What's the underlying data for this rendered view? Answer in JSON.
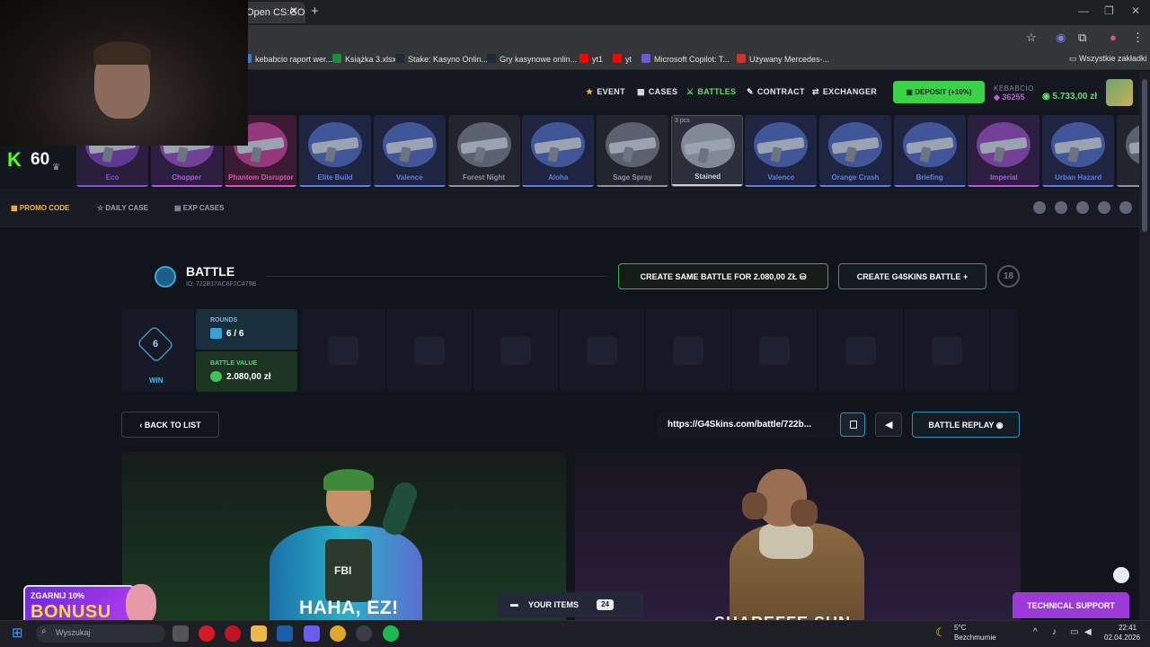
{
  "browser": {
    "tab_title": "Open CS:GO",
    "tab_close": "✕",
    "new_tab": "+",
    "bookmarks": [
      {
        "label": "kebabcio raport wer...",
        "color": "#3a7bd5"
      },
      {
        "label": "Książka 3.xlsx",
        "color": "#1e8e3e"
      },
      {
        "label": "Stake: Kasyno Onlin...",
        "color": "#1a2c38"
      },
      {
        "label": "Gry kasynowe onlin...",
        "color": "#1a2c38"
      },
      {
        "label": "yt1",
        "color": "#ff0000"
      },
      {
        "label": "yt",
        "color": "#ff0000"
      },
      {
        "label": "Microsoft Copilot: T...",
        "color": "#6b5bd6"
      },
      {
        "label": "Używany Mercedes-...",
        "color": "#d93025"
      }
    ],
    "all_bookmarks": "Wszystkie zakładki"
  },
  "header": {
    "nav": [
      {
        "label": "EVENT",
        "icon": "★",
        "color": "#f5b83d"
      },
      {
        "label": "CASES",
        "icon": "▦",
        "color": "#e6e8ee"
      },
      {
        "label": "BATTLES",
        "icon": "⚔",
        "color": "#5ce06b"
      },
      {
        "label": "CONTRACT",
        "icon": "✎",
        "color": "#e6e8ee"
      },
      {
        "label": "EXCHANGER",
        "icon": "⇄",
        "color": "#e6e8ee"
      }
    ],
    "deposit_label": "DEPOSIT (+10%)",
    "user_name": "KEBABCIO",
    "user_xp": "36255",
    "user_balance": "5.733,00 zł"
  },
  "level": {
    "k": "K",
    "value": "60"
  },
  "live_drops": {
    "pcs_label": "3 pcs",
    "items": [
      {
        "name": "Eco",
        "color": "#8a4fd8",
        "bg": "#2a1f3a"
      },
      {
        "name": "Chopper",
        "color": "#b05ce0",
        "bg": "#2c1e3e"
      },
      {
        "name": "Phantom Disruptor",
        "color": "#e04fb8",
        "bg": "#3a1b32"
      },
      {
        "name": "Elite Build",
        "color": "#5d7fe0",
        "bg": "#1f2540"
      },
      {
        "name": "Valence",
        "color": "#5d7fe0",
        "bg": "#1f2540"
      },
      {
        "name": "Forest Night",
        "color": "#8b93a6",
        "bg": "#22252e"
      },
      {
        "name": "Aloha",
        "color": "#5d7fe0",
        "bg": "#1f2540"
      },
      {
        "name": "Sage Spray",
        "color": "#8b93a6",
        "bg": "#22252e"
      },
      {
        "name": "Stained",
        "color": "#c9d3e0",
        "bg": "#2a2f3a"
      },
      {
        "name": "Valence",
        "color": "#5d7fe0",
        "bg": "#1f2540"
      },
      {
        "name": "Orange Crash",
        "color": "#5d7fe0",
        "bg": "#1f2540"
      },
      {
        "name": "Briefing",
        "color": "#5d7fe0",
        "bg": "#1f2540"
      },
      {
        "name": "Imperial",
        "color": "#b05ce0",
        "bg": "#2c1e3e"
      },
      {
        "name": "Urban Hazard",
        "color": "#5d7fe0",
        "bg": "#1f2540"
      },
      {
        "name": "Sa",
        "color": "#8b93a6",
        "bg": "#22252e"
      }
    ]
  },
  "subnav": {
    "promo": "PROMO CODE",
    "daily": "DAILY CASE",
    "exp": "EXP CASES"
  },
  "battle": {
    "title": "BATTLE",
    "id": "ID: 722B17AC6F2C479B",
    "create_same": "CREATE SAME BATTLE FOR 2.080,00 ZŁ",
    "create_g4": "CREATE G4SKINS BATTLE",
    "age": "18",
    "win_number": "6",
    "win_label": "WIN",
    "rounds_label": "ROUNDS",
    "rounds_value": "6 / 6",
    "value_label": "BATTLE VALUE",
    "value_value": "2.080,00 zł",
    "back_label": "BACK TO LIST",
    "url": "https://G4Skins.com/battle/722b...",
    "replay_label": "BATTLE REPLAY"
  },
  "players": {
    "p1_text": "HAHA, EZ!",
    "p2_text": "SHAREFFE SUN"
  },
  "floating": {
    "your_items": "YOUR ITEMS",
    "items_count": "24",
    "support": "TECHNICAL SUPPORT",
    "bonus_top": "ZGARNIJ 10%",
    "bonus_main": "BONUSU"
  },
  "taskbar": {
    "search_placeholder": "Wyszukaj",
    "weather_temp": "5°C",
    "weather_desc": "Bezchmurnie",
    "time": "22:41",
    "date": "02.04.2026"
  }
}
